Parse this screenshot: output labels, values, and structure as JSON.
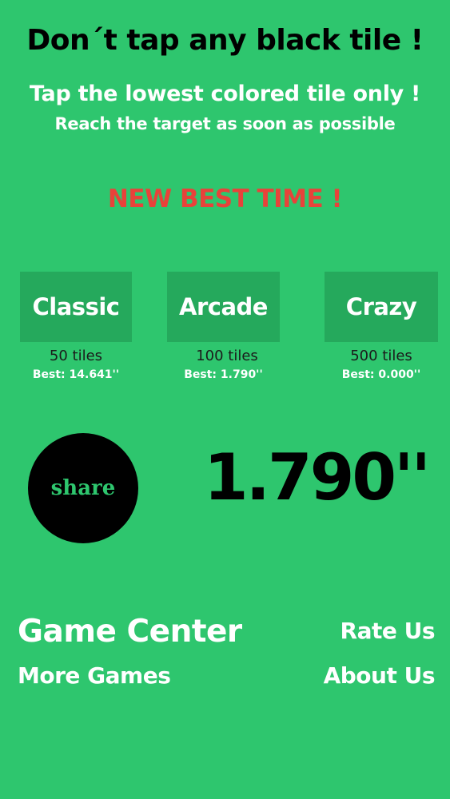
{
  "header": {
    "title": "Don´t tap any black tile !",
    "instruction": "Tap the lowest colored tile only !",
    "goal": "Reach the target as soon as possible"
  },
  "banner": {
    "new_best": "NEW BEST TIME !"
  },
  "modes": [
    {
      "label": "Classic",
      "tiles": "50 tiles",
      "best": "Best: 14.641''"
    },
    {
      "label": "Arcade",
      "tiles": "100 tiles",
      "best": "Best: 1.790''"
    },
    {
      "label": "Crazy",
      "tiles": "500 tiles",
      "best": "Best: 0.000''"
    }
  ],
  "result": {
    "share_label": "share",
    "time": "1.790''"
  },
  "menu": {
    "game_center": "Game Center",
    "more_games": "More Games",
    "rate_us": "Rate Us",
    "about_us": "About Us"
  },
  "colors": {
    "background": "#2ec66e",
    "mode_button": "#25a95c",
    "new_best": "#e8423a"
  }
}
